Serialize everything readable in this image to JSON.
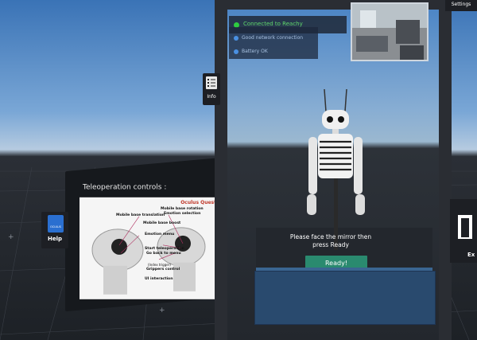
{
  "controls_panel": {
    "title": "Teleoperation controls :",
    "brand": "Oculus Quest",
    "labels": {
      "mobile_base_rotation": "Mobile base rotation",
      "emotion_selection": "Emotion selection",
      "mobile_base_translation": "Mobile base translation",
      "mobile_base_boost": "Mobile base boost",
      "emotion_menu": "Emotion menu",
      "start_teleoperation": "Start teleoperation",
      "go_back_to_menu": "Go back to menu",
      "grippers_control_small": "(Index trigger)",
      "grippers_control": "Grippers control",
      "ui_interaction": "UI interaction"
    }
  },
  "help_tab": {
    "label": "Help",
    "icon": "help-badge-icon",
    "icon_text": "OCULUS"
  },
  "info_tab": {
    "label": "Info",
    "icon": "checklist-icon"
  },
  "settings_tab": {
    "label": "Settings"
  },
  "right_tab": {
    "label": "Ex"
  },
  "status": {
    "connection": "Connected to Reachy",
    "network": "Good network connection",
    "battery": "Battery OK",
    "accent": "#2ecc40"
  },
  "mirror": {
    "message_line1": "Please face the mirror then",
    "message_line2": "press Ready",
    "ready_label": "Ready!"
  }
}
